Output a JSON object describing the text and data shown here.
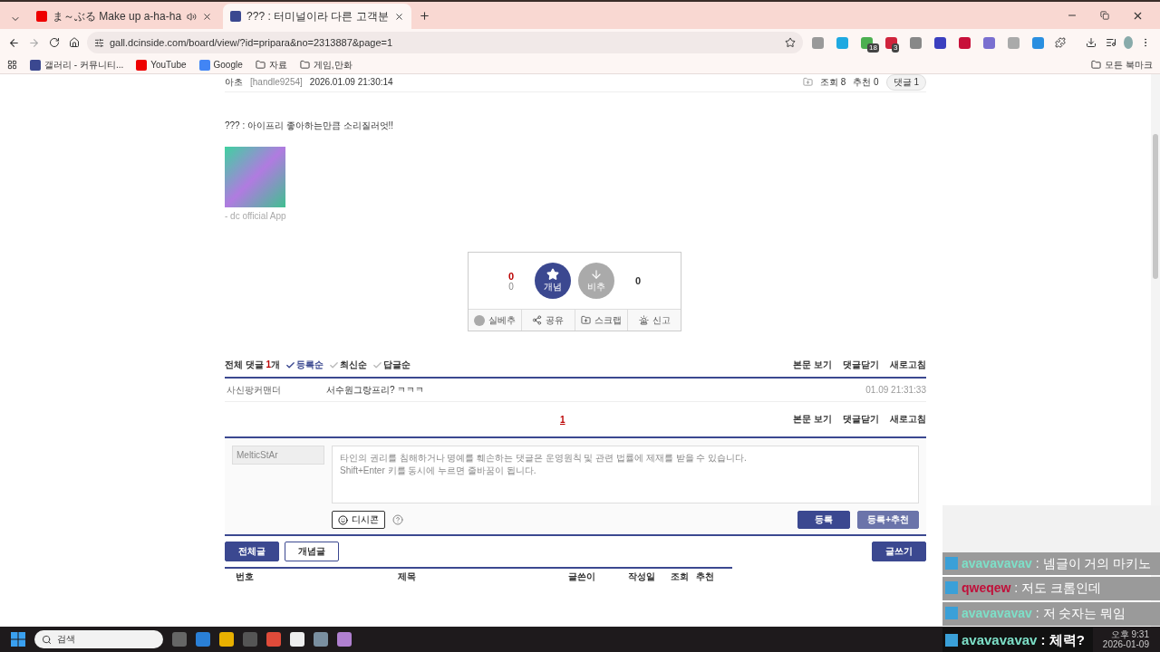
{
  "browser": {
    "tabs": [
      {
        "title": "ま～ぶる Make up a-ha-ha",
        "kind": "youtube",
        "audio": true,
        "selected": false
      },
      {
        "title": "??? : 터미널이라 다른 고객분",
        "kind": "dc",
        "audio": false,
        "selected": true
      }
    ],
    "url": "gall.dcinside.com/board/view/?id=pripara&no=2313887&page=1",
    "extension_badges": [
      "18",
      "3"
    ],
    "bookmarks": [
      {
        "label": "갤러리 - 커뮤니티...",
        "kind": "dc"
      },
      {
        "label": "YouTube",
        "kind": "youtube"
      },
      {
        "label": "Google",
        "kind": "google"
      },
      {
        "label": "자료",
        "kind": "folder"
      },
      {
        "label": "게임,만화",
        "kind": "folder"
      }
    ],
    "all_bookmarks": "모든 북마크"
  },
  "post": {
    "author": "아초",
    "handle": "[handle9254]",
    "date": "2026.01.09 21:30:14",
    "views": "조회 8",
    "recommends": "추천 0",
    "comments": "댓글 1",
    "body": "??? : 아이프리 좋아하는만큼 소리질러엇!!",
    "signature": "- dc official App"
  },
  "vote": {
    "up_count": "0",
    "up_sub": "0",
    "up_label": "개념",
    "down_label": "비추",
    "down_count": "0",
    "actions": [
      {
        "label": "실베추",
        "kind": "best"
      },
      {
        "label": "공유",
        "kind": "share"
      },
      {
        "label": "스크랩",
        "kind": "scrap"
      },
      {
        "label": "신고",
        "kind": "report"
      }
    ]
  },
  "comments": {
    "title": "전체 댓글",
    "count": "1",
    "unit": "개",
    "sorts": [
      {
        "label": "등록순",
        "selected": true
      },
      {
        "label": "최신순",
        "selected": false
      },
      {
        "label": "답글순",
        "selected": false
      }
    ],
    "links": [
      "본문 보기",
      "댓글닫기",
      "새로고침"
    ],
    "items": [
      {
        "author": "사신팡커맨더",
        "text": "서수원그랑프리? ㅋㅋㅋ",
        "date": "01.09 21:31:33"
      }
    ],
    "pages": [
      {
        "label": "1",
        "selected": true
      }
    ],
    "bottom_links": [
      "본문 보기",
      "댓글닫기",
      "새로고침"
    ]
  },
  "comment_form": {
    "nickname": "MelticStAr",
    "placeholder": "타인의 권리를 침해하거나 명예를 훼손하는 댓글은 운영원칙 및 관련 법률에 제재를 받을 수 있습니다.\nShift+Enter 키를 동시에 누르면 줄바꿈이 됩니다.",
    "dccon": "디시콘",
    "submit": "등록",
    "submit_recommend": "등록+추천"
  },
  "board_buttons": [
    {
      "label": "전체글",
      "selected": true
    },
    {
      "label": "개념글",
      "selected": false
    }
  ],
  "write_button": "글쓰기",
  "list_columns": [
    "번호",
    "제목",
    "글쓴이",
    "작성일",
    "조회",
    "추천"
  ],
  "chat": [
    {
      "user": "avavavavav",
      "color": "#7de0c8",
      "sep": ":",
      "text": "넴글이 거의 마키노",
      "kind": "message"
    },
    {
      "user": "qweqew",
      "color": "#c0103a",
      "sep": ":",
      "text": "저도 크롬인데",
      "kind": "message"
    },
    {
      "user": "avavavavav",
      "color": "#7de0c8",
      "sep": ":",
      "text": "저 숫자는 뭐임",
      "kind": "message"
    },
    {
      "user": "avavavavav",
      "color": "#7de0c8",
      "sep": ":",
      "text": "체력?",
      "kind": "latest"
    }
  ],
  "taskbar": {
    "search": "검색",
    "time": "오후 9:31",
    "date": "2026-01-09"
  }
}
